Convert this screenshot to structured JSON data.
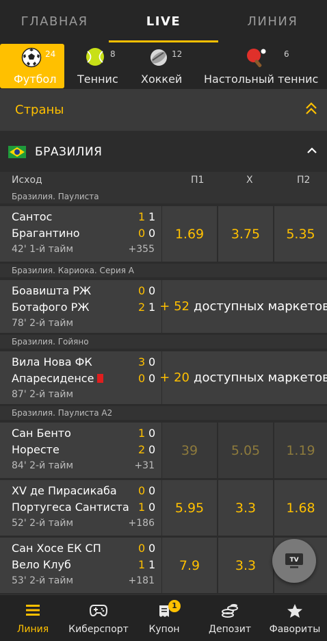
{
  "top_tabs": [
    {
      "label": "ГЛАВНАЯ"
    },
    {
      "label": "LIVE"
    },
    {
      "label": "ЛИНИЯ"
    }
  ],
  "sports": [
    {
      "label": "Футбол",
      "count": "24",
      "icon": "soccer-ball-icon"
    },
    {
      "label": "Теннис",
      "count": "8",
      "icon": "tennis-ball-icon"
    },
    {
      "label": "Хоккей",
      "count": "12",
      "icon": "hockey-puck-icon"
    },
    {
      "label": "Настольный теннис",
      "count": "6",
      "icon": "table-tennis-icon"
    }
  ],
  "countries_label": "Страны",
  "country": {
    "name": "БРАЗИЛИЯ",
    "flag": "brazil-flag-icon"
  },
  "columns": {
    "outcome": "Исход",
    "p1": "П1",
    "x": "Х",
    "p2": "П2"
  },
  "leagues": [
    {
      "name": "Бразилия. Паулиста"
    },
    {
      "name": "Бразилия. Кариока. Серия А"
    },
    {
      "name": "Бразилия. Гойяно"
    },
    {
      "name": "Бразилия. Паулиста А2"
    }
  ],
  "matches": [
    {
      "team1": "Сантос",
      "team2": "Брагантино",
      "s1a": "1",
      "s1b": "1",
      "s2a": "0",
      "s2b": "0",
      "time": "42' 1-й тайм",
      "more": "+355",
      "p1": "1.69",
      "x": "3.75",
      "p2": "5.35"
    },
    {
      "team1": "Боавишта РЖ",
      "team2": "Ботафого РЖ",
      "s1a": "0",
      "s1b": "0",
      "s2a": "2",
      "s2b": "1",
      "time": "78' 2-й тайм",
      "markets_count": "+ 52",
      "markets_text": "доступных маркетов"
    },
    {
      "team1": "Вила Нова ФК",
      "team2": "Апаресиденсе",
      "s1a": "3",
      "s1b": "0",
      "s2a": "0",
      "s2b": "0",
      "time": "87' 2-й тайм",
      "markets_count": "+ 20",
      "markets_text": "доступных маркетов"
    },
    {
      "team1": "Сан Бенто",
      "team2": "Норесте",
      "s1a": "1",
      "s1b": "0",
      "s2a": "2",
      "s2b": "0",
      "time": "84' 2-й тайм",
      "more": "+31",
      "p1": "39",
      "x": "5.05",
      "p2": "1.19"
    },
    {
      "team1": "XV де Пирасикаба",
      "team2": "Португеса Сантиста",
      "s1a": "0",
      "s1b": "0",
      "s2a": "1",
      "s2b": "0",
      "time": "52' 2-й тайм",
      "more": "+186",
      "p1": "5.95",
      "x": "3.3",
      "p2": "1.68"
    },
    {
      "team1": "Сан Хосе ЕК СП",
      "team2": "Вело Клуб",
      "s1a": "0",
      "s1b": "0",
      "s2a": "1",
      "s2b": "1",
      "time": "53' 2-й тайм",
      "more": "+181",
      "p1": "7.9",
      "x": "3.3",
      "p2": ""
    }
  ],
  "tv_label": "TV",
  "bottom_nav": [
    {
      "label": "Линия"
    },
    {
      "label": "Киберспорт"
    },
    {
      "label": "Купон",
      "badge": "1"
    },
    {
      "label": "Депозит"
    },
    {
      "label": "Фавориты"
    }
  ],
  "colors": {
    "accent": "#ffc000",
    "background": "#2c2c2c",
    "cell": "#3e3e3e",
    "red_card": "#e01e1e"
  }
}
